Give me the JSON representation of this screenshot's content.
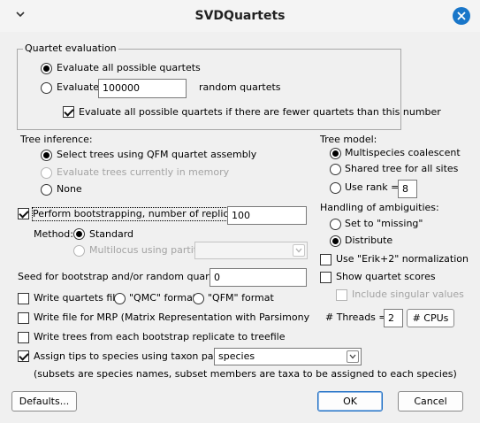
{
  "window": {
    "title": "SVDQuartets"
  },
  "quartet_evaluation": {
    "legend": "Quartet evaluation",
    "option_all": "Evaluate all possible quartets",
    "option_evaluate": "Evaluate",
    "evaluate_value": "100000",
    "random_suffix": "random quartets",
    "fewer_check": "Evaluate all possible quartets if there are fewer quartets than this number"
  },
  "tree_inference": {
    "heading": "Tree inference:",
    "qfm": "Select trees using QFM quartet assembly",
    "memory": "Evaluate trees currently in memory",
    "none": "None"
  },
  "tree_model": {
    "heading": "Tree model:",
    "multispecies": "Multispecies coalescent",
    "shared": "Shared tree for all sites",
    "use_rank": "Use rank =",
    "rank_value": "8"
  },
  "ambiguities": {
    "heading": "Handling of ambiguities:",
    "missing": "Set to \"missing\"",
    "distribute": "Distribute"
  },
  "erik_check": "Use \"Erik+2\" normalization",
  "show_scores": "Show quartet scores",
  "singular": "Include singular values",
  "bootstrap": {
    "check": "Perform bootstrapping, number of replicates =",
    "replicates": "100",
    "method_label": "Method:",
    "standard": "Standard",
    "multilocus": "Multilocus using partition",
    "partition_value": ""
  },
  "seed": {
    "label": "Seed for bootstrap and/or random quartets =",
    "value": "0"
  },
  "write_quartets": {
    "check": "Write quartets file:",
    "qmc": "\"QMC\" format",
    "qfm": "\"QFM\" format"
  },
  "mrp_check": "Write file for MRP (Matrix Representation with Parsimony",
  "bootstrap_trees_check": "Write trees from each bootstrap replicate to treefile",
  "assign": {
    "check": "Assign tips to species using taxon partition",
    "partition": "species",
    "note": "(subsets are species names, subset members are taxa to be assigned to each species)"
  },
  "threads": {
    "label": "# Threads =",
    "value": "2",
    "cpus_button": "# CPUs"
  },
  "buttons": {
    "defaults": "Defaults...",
    "ok": "OK",
    "cancel": "Cancel"
  },
  "icons": {
    "title_left": "chevron-down-icon",
    "close": "close-icon"
  },
  "colors": {
    "accent": "#1976c9"
  }
}
